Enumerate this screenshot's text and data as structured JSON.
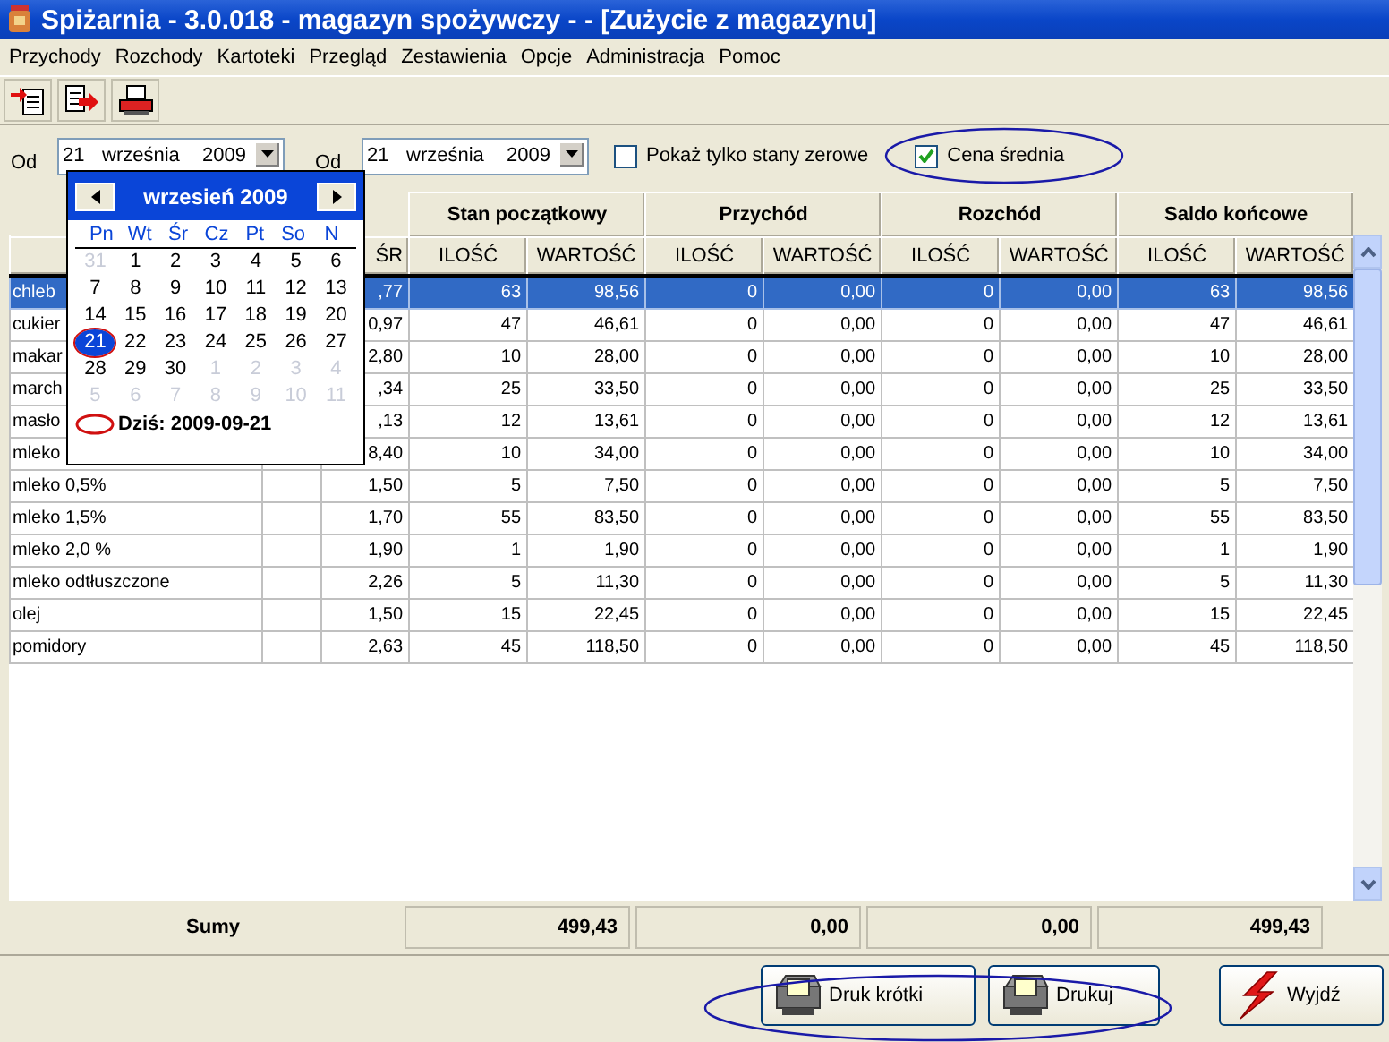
{
  "window": {
    "title": "Spiżarnia - 3.0.018 - magazyn spożywczy -  - [Zużycie z magazynu]"
  },
  "menu": [
    "Przychody",
    "Rozchody",
    "Kartoteki",
    "Przegląd",
    "Zestawienia",
    "Opcje",
    "Administracja",
    "Pomoc"
  ],
  "toolbar": [
    {
      "kind": "import"
    },
    {
      "kind": "export"
    },
    {
      "kind": "print"
    }
  ],
  "filters": {
    "from": {
      "label": "Od",
      "day": "21",
      "month": "września",
      "year": "2009"
    },
    "to": {
      "label": "Od",
      "day": "21",
      "month": "września",
      "year": "2009"
    },
    "zero_only": {
      "label": "Pokaż tylko stany zerowe",
      "checked": false
    },
    "avg_price": {
      "label": "Cena średnia",
      "checked": true
    }
  },
  "calendar": {
    "title": "wrzesień 2009",
    "weekdays": [
      "Pn",
      "Wt",
      "Śr",
      "Cz",
      "Pt",
      "So",
      "N"
    ],
    "weeks": [
      [
        {
          "day": "31",
          "outside": true,
          "selected": false
        },
        {
          "day": "1",
          "outside": false,
          "selected": false
        },
        {
          "day": "2",
          "outside": false,
          "selected": false
        },
        {
          "day": "3",
          "outside": false,
          "selected": false
        },
        {
          "day": "4",
          "outside": false,
          "selected": false
        },
        {
          "day": "5",
          "outside": false,
          "selected": false
        },
        {
          "day": "6",
          "outside": false,
          "selected": false
        }
      ],
      [
        {
          "day": "7",
          "outside": false,
          "selected": false
        },
        {
          "day": "8",
          "outside": false,
          "selected": false
        },
        {
          "day": "9",
          "outside": false,
          "selected": false
        },
        {
          "day": "10",
          "outside": false,
          "selected": false
        },
        {
          "day": "11",
          "outside": false,
          "selected": false
        },
        {
          "day": "12",
          "outside": false,
          "selected": false
        },
        {
          "day": "13",
          "outside": false,
          "selected": false
        }
      ],
      [
        {
          "day": "14",
          "outside": false,
          "selected": false
        },
        {
          "day": "15",
          "outside": false,
          "selected": false
        },
        {
          "day": "16",
          "outside": false,
          "selected": false
        },
        {
          "day": "17",
          "outside": false,
          "selected": false
        },
        {
          "day": "18",
          "outside": false,
          "selected": false
        },
        {
          "day": "19",
          "outside": false,
          "selected": false
        },
        {
          "day": "20",
          "outside": false,
          "selected": false
        }
      ],
      [
        {
          "day": "21",
          "outside": false,
          "selected": true
        },
        {
          "day": "22",
          "outside": false,
          "selected": false
        },
        {
          "day": "23",
          "outside": false,
          "selected": false
        },
        {
          "day": "24",
          "outside": false,
          "selected": false
        },
        {
          "day": "25",
          "outside": false,
          "selected": false
        },
        {
          "day": "26",
          "outside": false,
          "selected": false
        },
        {
          "day": "27",
          "outside": false,
          "selected": false
        }
      ],
      [
        {
          "day": "28",
          "outside": false,
          "selected": false
        },
        {
          "day": "29",
          "outside": false,
          "selected": false
        },
        {
          "day": "30",
          "outside": false,
          "selected": false
        },
        {
          "day": "1",
          "outside": true,
          "selected": false
        },
        {
          "day": "2",
          "outside": true,
          "selected": false
        },
        {
          "day": "3",
          "outside": true,
          "selected": false
        },
        {
          "day": "4",
          "outside": true,
          "selected": false
        }
      ],
      [
        {
          "day": "5",
          "outside": true,
          "selected": false
        },
        {
          "day": "6",
          "outside": true,
          "selected": false
        },
        {
          "day": "7",
          "outside": true,
          "selected": false
        },
        {
          "day": "8",
          "outside": true,
          "selected": false
        },
        {
          "day": "9",
          "outside": true,
          "selected": false
        },
        {
          "day": "10",
          "outside": true,
          "selected": false
        },
        {
          "day": "11",
          "outside": true,
          "selected": false
        }
      ]
    ],
    "today": "Dziś: 2009-09-21"
  },
  "table": {
    "groups": [
      "Stan początkowy",
      "Przychód",
      "Rozchód",
      "Saldo końcowe"
    ],
    "price_header": "ŚR",
    "subcolumns": [
      "ILOŚĆ",
      "WARTOŚĆ",
      "ILOŚĆ",
      "WARTOŚĆ",
      "ILOŚĆ",
      "WARTOŚĆ",
      "ILOŚĆ",
      "WARTOŚĆ"
    ],
    "rows": [
      {
        "selected": true,
        "cells": [
          "chleb",
          ",77",
          "63",
          "98,56",
          "0",
          "0,00",
          "0",
          "0,00",
          "63",
          "98,56"
        ]
      },
      {
        "selected": false,
        "cells": [
          "cukier",
          "0,97",
          "47",
          "46,61",
          "0",
          "0,00",
          "0",
          "0,00",
          "47",
          "46,61"
        ]
      },
      {
        "selected": false,
        "cells": [
          "makar",
          "2,80",
          "10",
          "28,00",
          "0",
          "0,00",
          "0",
          "0,00",
          "10",
          "28,00"
        ]
      },
      {
        "selected": false,
        "cells": [
          "march",
          ",34",
          "25",
          "33,50",
          "0",
          "0,00",
          "0",
          "0,00",
          "25",
          "33,50"
        ]
      },
      {
        "selected": false,
        "cells": [
          "masło",
          ",13",
          "12",
          "13,61",
          "0",
          "0,00",
          "0",
          "0,00",
          "12",
          "13,61"
        ]
      },
      {
        "selected": false,
        "cells": [
          "mleko",
          "8,40",
          "10",
          "34,00",
          "0",
          "0,00",
          "0",
          "0,00",
          "10",
          "34,00"
        ]
      },
      {
        "selected": false,
        "cells": [
          "mleko 0,5%",
          "1,50",
          "5",
          "7,50",
          "0",
          "0,00",
          "0",
          "0,00",
          "5",
          "7,50"
        ]
      },
      {
        "selected": false,
        "cells": [
          "mleko 1,5%",
          "1,70",
          "55",
          "83,50",
          "0",
          "0,00",
          "0",
          "0,00",
          "55",
          "83,50"
        ]
      },
      {
        "selected": false,
        "cells": [
          "mleko 2,0 %",
          "1,90",
          "1",
          "1,90",
          "0",
          "0,00",
          "0",
          "0,00",
          "1",
          "1,90"
        ]
      },
      {
        "selected": false,
        "cells": [
          "mleko odtłuszczone",
          "2,26",
          "5",
          "11,30",
          "0",
          "0,00",
          "0",
          "0,00",
          "5",
          "11,30"
        ]
      },
      {
        "selected": false,
        "cells": [
          "olej",
          "1,50",
          "15",
          "22,45",
          "0",
          "0,00",
          "0",
          "0,00",
          "15",
          "22,45"
        ]
      },
      {
        "selected": false,
        "cells": [
          "pomidory",
          "2,63",
          "45",
          "118,50",
          "0",
          "0,00",
          "0",
          "0,00",
          "45",
          "118,50"
        ]
      }
    ]
  },
  "totals": {
    "label": "Sumy",
    "values": [
      "499,43",
      "0,00",
      "0,00",
      "499,43"
    ]
  },
  "buttons": [
    {
      "label": "Druk krótki",
      "kind": "print"
    },
    {
      "label": "Drukuj",
      "kind": "print"
    },
    {
      "label": "Wyjdź",
      "kind": "exit"
    }
  ]
}
